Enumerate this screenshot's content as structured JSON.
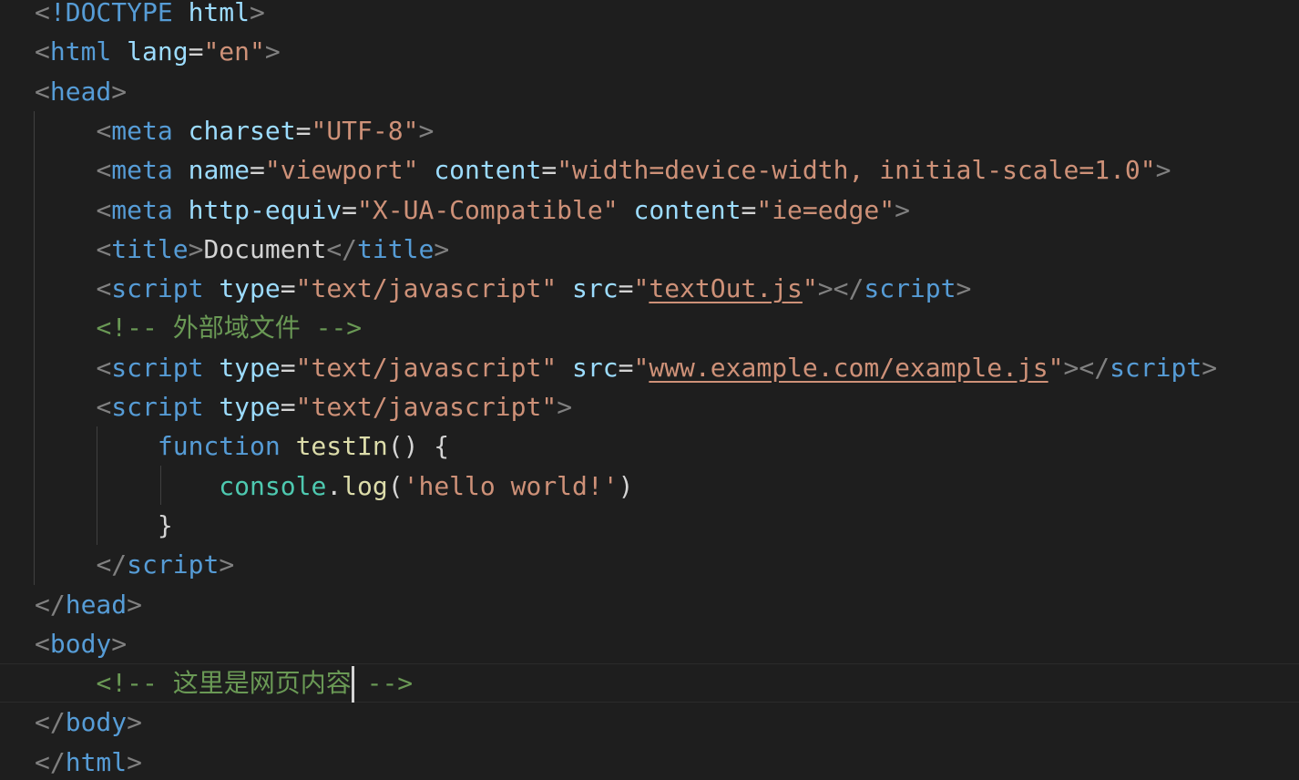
{
  "editor": {
    "lines": [
      {
        "tokens": [
          [
            "punct",
            "<"
          ],
          [
            "tag",
            "!DOCTYPE"
          ],
          [
            "text",
            " "
          ],
          [
            "attr",
            "html"
          ],
          [
            "punct",
            ">"
          ]
        ]
      },
      {
        "tokens": [
          [
            "punct",
            "<"
          ],
          [
            "tag",
            "html"
          ],
          [
            "text",
            " "
          ],
          [
            "attr",
            "lang"
          ],
          [
            "text",
            "="
          ],
          [
            "str",
            "\"en\""
          ],
          [
            "punct",
            ">"
          ]
        ]
      },
      {
        "tokens": [
          [
            "punct",
            "<"
          ],
          [
            "tag",
            "head"
          ],
          [
            "punct",
            ">"
          ]
        ]
      },
      {
        "tokens": [
          [
            "text",
            "    "
          ],
          [
            "punct",
            "<"
          ],
          [
            "tag",
            "meta"
          ],
          [
            "text",
            " "
          ],
          [
            "attr",
            "charset"
          ],
          [
            "text",
            "="
          ],
          [
            "str",
            "\"UTF-8\""
          ],
          [
            "punct",
            ">"
          ]
        ]
      },
      {
        "tokens": [
          [
            "text",
            "    "
          ],
          [
            "punct",
            "<"
          ],
          [
            "tag",
            "meta"
          ],
          [
            "text",
            " "
          ],
          [
            "attr",
            "name"
          ],
          [
            "text",
            "="
          ],
          [
            "str",
            "\"viewport\""
          ],
          [
            "text",
            " "
          ],
          [
            "attr",
            "content"
          ],
          [
            "text",
            "="
          ],
          [
            "str",
            "\"width=device-width, initial-scale=1.0\""
          ],
          [
            "punct",
            ">"
          ]
        ]
      },
      {
        "tokens": [
          [
            "text",
            "    "
          ],
          [
            "punct",
            "<"
          ],
          [
            "tag",
            "meta"
          ],
          [
            "text",
            " "
          ],
          [
            "attr",
            "http-equiv"
          ],
          [
            "text",
            "="
          ],
          [
            "str",
            "\"X-UA-Compatible\""
          ],
          [
            "text",
            " "
          ],
          [
            "attr",
            "content"
          ],
          [
            "text",
            "="
          ],
          [
            "str",
            "\"ie=edge\""
          ],
          [
            "punct",
            ">"
          ]
        ]
      },
      {
        "tokens": [
          [
            "text",
            "    "
          ],
          [
            "punct",
            "<"
          ],
          [
            "tag",
            "title"
          ],
          [
            "punct",
            ">"
          ],
          [
            "text",
            "Document"
          ],
          [
            "punct",
            "</"
          ],
          [
            "tag",
            "title"
          ],
          [
            "punct",
            ">"
          ]
        ]
      },
      {
        "tokens": [
          [
            "text",
            "    "
          ],
          [
            "punct",
            "<"
          ],
          [
            "tag",
            "script"
          ],
          [
            "text",
            " "
          ],
          [
            "attr",
            "type"
          ],
          [
            "text",
            "="
          ],
          [
            "str",
            "\"text/javascript\""
          ],
          [
            "text",
            " "
          ],
          [
            "attr",
            "src"
          ],
          [
            "text",
            "="
          ],
          [
            "str",
            "\""
          ],
          [
            "link",
            "textOut.js"
          ],
          [
            "str",
            "\""
          ],
          [
            "punct",
            "></"
          ],
          [
            "tag",
            "script"
          ],
          [
            "punct",
            ">"
          ]
        ]
      },
      {
        "tokens": [
          [
            "text",
            "    "
          ],
          [
            "comment",
            "<!-- 外部域文件 -->"
          ]
        ]
      },
      {
        "tokens": [
          [
            "text",
            "    "
          ],
          [
            "punct",
            "<"
          ],
          [
            "tag",
            "script"
          ],
          [
            "text",
            " "
          ],
          [
            "attr",
            "type"
          ],
          [
            "text",
            "="
          ],
          [
            "str",
            "\"text/javascript\""
          ],
          [
            "text",
            " "
          ],
          [
            "attr",
            "src"
          ],
          [
            "text",
            "="
          ],
          [
            "str",
            "\""
          ],
          [
            "link",
            "www.example.com/example.js"
          ],
          [
            "str",
            "\""
          ],
          [
            "punct",
            "></"
          ],
          [
            "tag",
            "script"
          ],
          [
            "punct",
            ">"
          ]
        ]
      },
      {
        "tokens": [
          [
            "text",
            "    "
          ],
          [
            "punct",
            "<"
          ],
          [
            "tag",
            "script"
          ],
          [
            "text",
            " "
          ],
          [
            "attr",
            "type"
          ],
          [
            "text",
            "="
          ],
          [
            "str",
            "\"text/javascript\""
          ],
          [
            "punct",
            ">"
          ]
        ]
      },
      {
        "tokens": [
          [
            "text",
            "        "
          ],
          [
            "kw",
            "function"
          ],
          [
            "text",
            " "
          ],
          [
            "fn",
            "testIn"
          ],
          [
            "text",
            "() {"
          ]
        ]
      },
      {
        "tokens": [
          [
            "text",
            "            "
          ],
          [
            "obj",
            "console"
          ],
          [
            "text",
            "."
          ],
          [
            "fn",
            "log"
          ],
          [
            "text",
            "("
          ],
          [
            "str",
            "'hello world!'"
          ],
          [
            "text",
            ")"
          ]
        ]
      },
      {
        "tokens": [
          [
            "text",
            "        }"
          ]
        ]
      },
      {
        "tokens": [
          [
            "text",
            "    "
          ],
          [
            "punct",
            "</"
          ],
          [
            "tag",
            "script"
          ],
          [
            "punct",
            ">"
          ]
        ]
      },
      {
        "tokens": [
          [
            "punct",
            "</"
          ],
          [
            "tag",
            "head"
          ],
          [
            "punct",
            ">"
          ]
        ]
      },
      {
        "tokens": [
          [
            "punct",
            "<"
          ],
          [
            "tag",
            "body"
          ],
          [
            "punct",
            ">"
          ]
        ]
      },
      {
        "tokens": [
          [
            "text",
            "    "
          ],
          [
            "comment",
            "<!-- 这里是网页内容"
          ],
          [
            "cursor",
            ""
          ],
          [
            "comment",
            " -->"
          ]
        ],
        "active": true
      },
      {
        "tokens": [
          [
            "punct",
            "</"
          ],
          [
            "tag",
            "body"
          ],
          [
            "punct",
            ">"
          ]
        ]
      },
      {
        "tokens": [
          [
            "punct",
            "</"
          ],
          [
            "tag",
            "html"
          ],
          [
            "punct",
            ">"
          ]
        ]
      }
    ]
  },
  "colors": {
    "background": "#1e1e1e",
    "tag": "#569cd6",
    "attribute": "#9cdcfe",
    "string": "#ce9178",
    "comment": "#6a9955",
    "function": "#dcdcaa",
    "object": "#4ec9b0",
    "punctuation": "#808080",
    "text": "#d4d4d4"
  }
}
